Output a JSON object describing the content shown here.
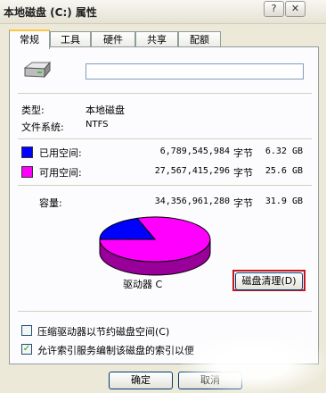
{
  "window": {
    "title": "本地磁盘 (C:) 属性",
    "help_button": "?",
    "close_button": "✕"
  },
  "tabs": [
    {
      "label": "常规",
      "active": true
    },
    {
      "label": "工具"
    },
    {
      "label": "硬件"
    },
    {
      "label": "共享"
    },
    {
      "label": "配额"
    }
  ],
  "general": {
    "name_value": "",
    "type_label": "类型:",
    "type_value": "本地磁盘",
    "fs_label": "文件系统:",
    "fs_value": "NTFS",
    "used": {
      "label": "已用空间:",
      "bytes": "6,789,545,984",
      "unit": "字节",
      "size": "6.32 GB",
      "color": "#0000ff"
    },
    "free": {
      "label": "可用空间:",
      "bytes": "27,567,415,296",
      "unit": "字节",
      "size": "25.6 GB",
      "color": "#ff00ff"
    },
    "capacity": {
      "label": "容量:",
      "bytes": "34,356,961,280",
      "unit": "字节",
      "size": "31.9 GB"
    },
    "drive_label": "驱动器 C",
    "cleanup_button": "磁盘清理(D)",
    "used_fraction": 0.1976
  },
  "options": {
    "compress_label": "压缩驱动器以节约磁盘空间(C)",
    "compress_checked": false,
    "index_label": "允许索引服务编制该磁盘的索引以便",
    "index_checked": true
  },
  "buttons": {
    "ok": "确定",
    "cancel": "取消"
  },
  "icons": {
    "drive": "hard-drive-icon",
    "check": "check-icon"
  }
}
